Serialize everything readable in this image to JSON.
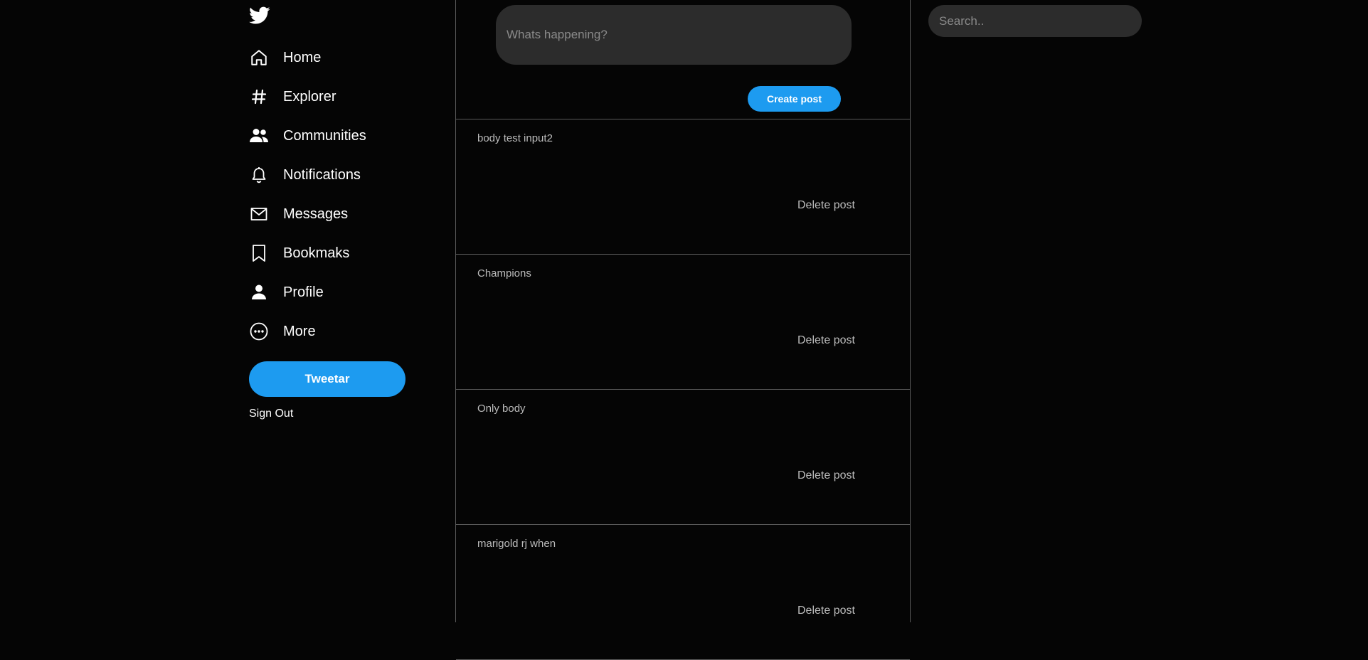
{
  "sidebar": {
    "logo_icon": "twitter-bird-icon",
    "items": [
      {
        "label": "Home",
        "icon": "home-icon"
      },
      {
        "label": "Explorer",
        "icon": "hashtag-icon"
      },
      {
        "label": "Communities",
        "icon": "people-icon"
      },
      {
        "label": "Notifications",
        "icon": "bell-icon"
      },
      {
        "label": "Messages",
        "icon": "envelope-icon"
      },
      {
        "label": "Bookmaks",
        "icon": "bookmark-icon"
      },
      {
        "label": "Profile",
        "icon": "person-icon"
      },
      {
        "label": "More",
        "icon": "more-circle-icon"
      }
    ],
    "tweet_button": "Tweetar",
    "sign_out": "Sign Out"
  },
  "composer": {
    "placeholder": "Whats happening?",
    "create_button": "Create post"
  },
  "posts": [
    {
      "body": "body test input2",
      "delete_label": "Delete post"
    },
    {
      "body": "Champions",
      "delete_label": "Delete post"
    },
    {
      "body": "Only body",
      "delete_label": "Delete post"
    },
    {
      "body": "marigold rj when",
      "delete_label": "Delete post"
    }
  ],
  "search": {
    "placeholder": "Search.."
  },
  "colors": {
    "background": "#050505",
    "accent": "#1d9bf0",
    "input_bg": "#2c2c2c",
    "divider": "#5a5a5a"
  }
}
